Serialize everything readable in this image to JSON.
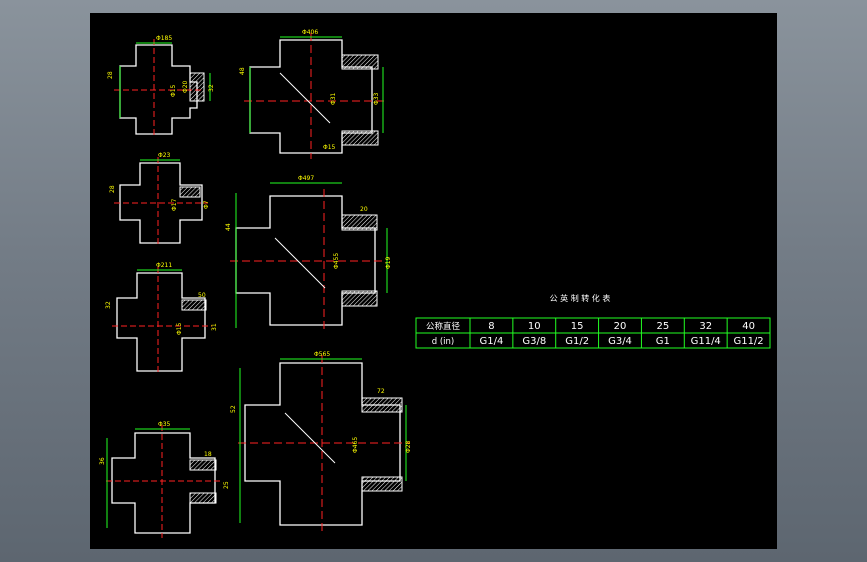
{
  "table": {
    "title": "公 英 制 转 化 表",
    "row1_label": "公称直径",
    "row2_label": "d (in)",
    "nominal": [
      "8",
      "10",
      "15",
      "20",
      "25",
      "32",
      "40"
    ],
    "inch": [
      "G1/4",
      "G3/8",
      "G1/2",
      "G3/4",
      "G1",
      "G11/4",
      "G11/2"
    ]
  },
  "dimensions": {
    "f1": {
      "top": "Φ185",
      "l1": "28",
      "l2": "Φ15",
      "l3": "Φ20",
      "l4": "32"
    },
    "f2": {
      "top": "Φ406",
      "l1": "48",
      "l2": "Φ31",
      "l3": "Φ33",
      "l4": "Φ15"
    },
    "f3": {
      "top": "Φ23",
      "l1": "28",
      "l2": "Φ17",
      "l3": "Φ7"
    },
    "f4": {
      "top": "Φ497",
      "l1": "44",
      "l2": "20",
      "l3": "Φ455",
      "l4": "Φ19"
    },
    "f5": {
      "top": "Φ211",
      "l1": "32",
      "l2": "50",
      "l3": "Φ15",
      "l4": "31"
    },
    "f6": {
      "top": "Φ565",
      "l1": "52",
      "l2": "72",
      "l3": "Φ465",
      "l4": "Φ28"
    },
    "f7": {
      "top": "Φ35",
      "l1": "36",
      "l2": "18",
      "l3": "25"
    }
  },
  "colors": {
    "outline": "#ffffff",
    "dimension": "#22ff22",
    "centerline": "#ff2222",
    "text": "#ffff00",
    "canvas": "#000000"
  }
}
